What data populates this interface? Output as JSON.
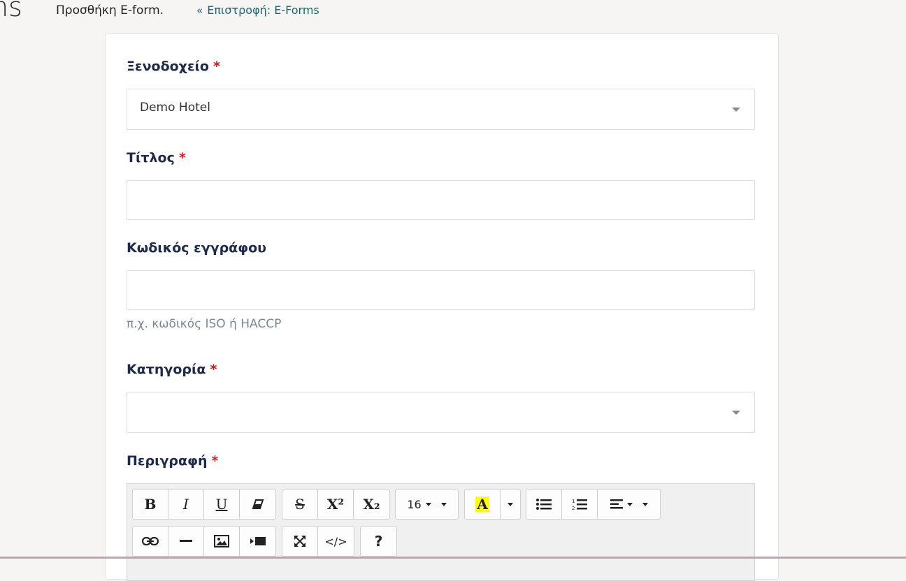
{
  "header": {
    "title": "rms",
    "subtitle": "Προσθήκη E-form.",
    "back_icon": "double-chevron-left-icon",
    "back_link": "Επιστροφή: E-Forms"
  },
  "form": {
    "hotel": {
      "label": "Ξενοδοχείο",
      "required_mark": "*",
      "value": "Demo Hotel"
    },
    "title": {
      "label": "Τίτλος",
      "required_mark": "*",
      "value": ""
    },
    "doc_code": {
      "label": "Κωδικός εγγράφου",
      "value": "",
      "help": "π.χ. κωδικός ISO ή HACCP"
    },
    "category": {
      "label": "Κατηγορία",
      "required_mark": "*",
      "value": ""
    },
    "description": {
      "label": "Περιγραφή",
      "required_mark": "*"
    }
  },
  "editor_toolbar": {
    "bold": "B",
    "italic": "I",
    "underline": "U",
    "strikethrough": "S",
    "superscript": "X²",
    "subscript": "X₂",
    "font_size": "16",
    "color_letter": "A",
    "help": "?",
    "code": "</>",
    "icons": [
      "eraser-icon",
      "list-bullet-icon",
      "list-numbered-icon",
      "align-icon",
      "link-icon",
      "horizontal-rule-icon",
      "image-icon",
      "video-icon",
      "fullscreen-icon"
    ],
    "highlight_color": "#ffff00"
  },
  "colors": {
    "accent": "#1a6670",
    "required": "#d01818",
    "label": "#1e2a4a"
  }
}
